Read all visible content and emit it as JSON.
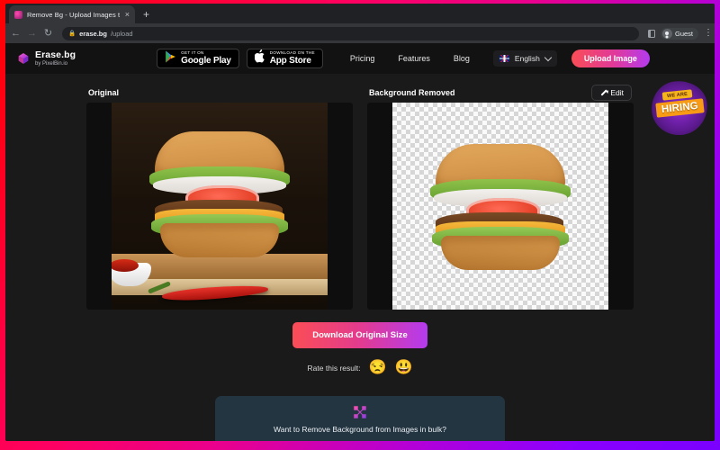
{
  "browser": {
    "tab": {
      "title": "Remove Bg - Upload Images t",
      "close_label": "×"
    },
    "new_tab_label": "+",
    "nav": {
      "back": "←",
      "forward": "→",
      "reload": "↻"
    },
    "omnibox": {
      "lock_icon": "lock-icon",
      "url_domain": "erase.bg",
      "url_path": "/upload"
    },
    "profile_label": "Guest",
    "side_panel_icon": "side-panel-icon",
    "menu_label": "⋮"
  },
  "header": {
    "logo": {
      "title": "Erase.bg",
      "subtitle": "by PixelBin.io",
      "mark": "erasebg-cube-icon"
    },
    "stores": [
      {
        "name": "google-play",
        "top_line": "GET IT ON",
        "main_line": "Google Play",
        "icon": "play-triangle-icon"
      },
      {
        "name": "app-store",
        "top_line": "Download on the",
        "main_line": "App Store",
        "icon": "apple-icon"
      }
    ],
    "nav_links": [
      "Pricing",
      "Features",
      "Blog"
    ],
    "language": {
      "label": "English",
      "flag": "uk-flag-icon",
      "chevron": "chevron-down-icon"
    },
    "upload_button": "Upload Image"
  },
  "hiring_badge": {
    "small_text": "WE ARE",
    "big_text": "HIRING"
  },
  "main": {
    "original_panel": {
      "title": "Original"
    },
    "result_panel": {
      "title": "Background Removed",
      "edit_button": "Edit",
      "edit_icon": "pencil-icon"
    },
    "download_button": "Download Original Size",
    "rating": {
      "label": "Rate this result:",
      "options": [
        {
          "name": "sad-emoji",
          "glyph": "😒"
        },
        {
          "name": "happy-emoji",
          "glyph": "😃"
        }
      ]
    },
    "bulk_banner": {
      "text": "Want to Remove Background from Images in bulk?",
      "logo": "pixelbin-x-icon"
    }
  },
  "colors": {
    "accent_pink": "#e33b8f",
    "accent_purple": "#b43bf0",
    "accent_red": "#fa4d56",
    "frame_gradient_start": "#ff0000",
    "frame_gradient_end": "#7a00ff",
    "page_bg": "#1a1a1a",
    "header_bg": "#121212",
    "banner_bg": "#243542"
  }
}
